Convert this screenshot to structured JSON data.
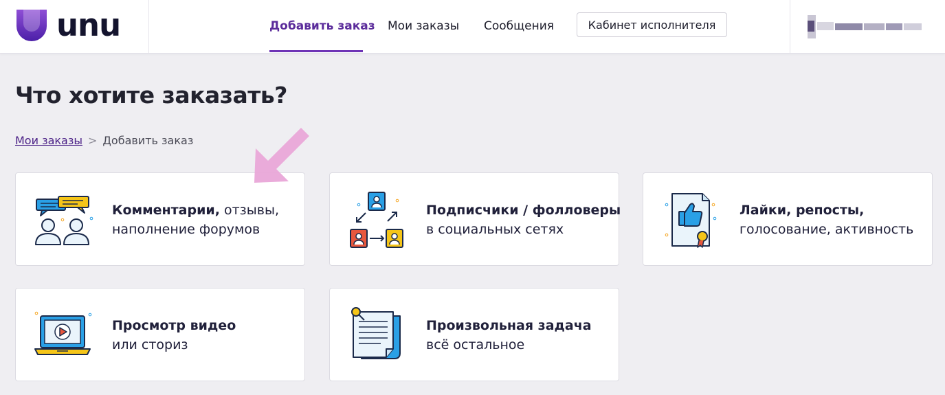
{
  "header": {
    "logo_text": "unu",
    "nav": [
      {
        "label": "Добавить заказ",
        "active": true
      },
      {
        "label": "Мои заказы",
        "active": false
      },
      {
        "label": "Сообщения",
        "active": false
      }
    ],
    "cabinet_button": "Кабинет исполнителя"
  },
  "page": {
    "title": "Что хотите заказать?",
    "breadcrumb": {
      "link": "Мои заказы",
      "separator": ">",
      "current": "Добавить заказ"
    }
  },
  "cards": [
    {
      "title_bold": "Комментарии,",
      "title_rest": " отзывы,",
      "subtitle": "наполнение форумов",
      "icon": "chat-users-icon"
    },
    {
      "title_bold": "Подписчики / фолловеры",
      "title_rest": "",
      "subtitle": "в социальных сетях",
      "icon": "followers-icon"
    },
    {
      "title_bold": "Лайки, репосты,",
      "title_rest": "",
      "subtitle": "голосование, активность",
      "icon": "thumbs-up-certificate-icon"
    },
    {
      "title_bold": "Просмотр видео",
      "title_rest": "",
      "subtitle": "или сториз",
      "icon": "laptop-video-icon"
    },
    {
      "title_bold": "Произвольная задача",
      "title_rest": "",
      "subtitle": "всё остальное",
      "icon": "document-pin-icon"
    }
  ],
  "colors": {
    "accent": "#6e34b6",
    "link": "#4a1f86",
    "annotation_arrow": "#e9a6d8",
    "background": "#efeef2"
  }
}
